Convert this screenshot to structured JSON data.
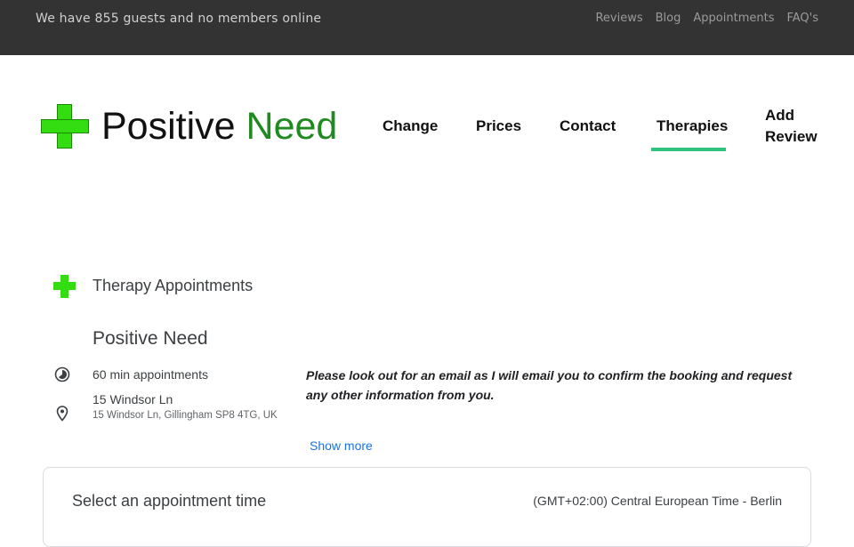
{
  "topbar": {
    "guests_text": "We have 855 guests and no members online",
    "links": [
      "Reviews",
      "Blog",
      "Appointments",
      "FAQ's"
    ]
  },
  "logo": {
    "word1": "Positive",
    "word2": "Need",
    "colors": {
      "cross": "#33dd11",
      "word2": "#1f8a1f"
    }
  },
  "nav": {
    "items": [
      "Change",
      "Prices",
      "Contact",
      "Therapies"
    ],
    "add_review_line1": "Add",
    "add_review_line2": "Review",
    "active": "Therapies",
    "active_color": "#2ec27e"
  },
  "booking": {
    "title": "Therapy Appointments",
    "org_name": "Positive Need",
    "duration": "60 min appointments",
    "address_line1": "15 Windsor Ln",
    "address_line2": "15 Windsor Ln, Gillingham SP8 4TG, UK",
    "notice": "Please look out for an email as I will email you to confirm the booking and request any other information from you.",
    "show_more": "Show more",
    "select_time": "Select an appointment time",
    "timezone": "(GMT+02:00) Central European Time - Berlin",
    "icons": {
      "duration": "clock-icon",
      "address": "location-pin-icon",
      "logo": "green-cross-icon"
    },
    "link_color": "#1a73e8"
  }
}
